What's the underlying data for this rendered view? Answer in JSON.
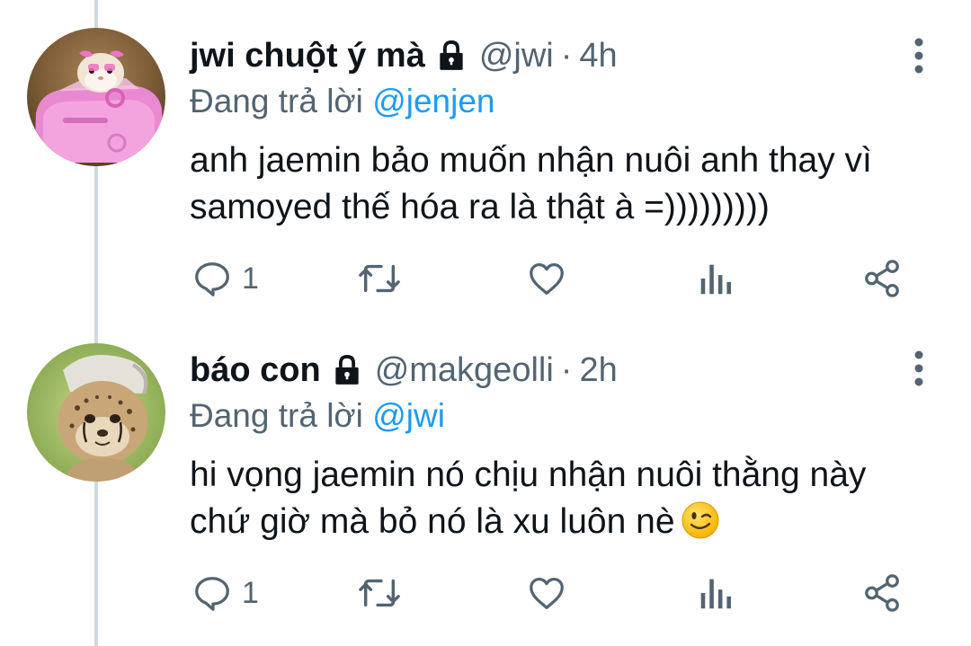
{
  "tweets": [
    {
      "display_name": "jwi chuột ý mà",
      "handle": "@jwi",
      "separator": "·",
      "time": "4h",
      "reply_prefix": "Đang trả lời",
      "reply_to": "@jenjen",
      "text_lines": [
        "anh jaemin bảo muốn nhận nuôi anh thay vì",
        "samoyed thế hóa ra là thật à =)))))))))"
      ],
      "reply_count": "1",
      "avatar_icon": "hamster-in-pink-car-avatar",
      "locked": true
    },
    {
      "display_name": "báo con",
      "handle": "@makgeolli",
      "separator": "·",
      "time": "2h",
      "reply_prefix": "Đang trả lời",
      "reply_to": "@jwi",
      "text_lines": [
        "hi vọng jaemin nó chịu nhận nuôi thằng này",
        "chứ giờ mà bỏ nó là xu luôn nè"
      ],
      "emoji": "winking-face",
      "reply_count": "1",
      "avatar_icon": "cheetah-cub-with-cap-avatar",
      "locked": true
    }
  ],
  "colors": {
    "link": "#1d9bf0",
    "secondary": "#536471",
    "thread_line": "#cfd9de"
  }
}
